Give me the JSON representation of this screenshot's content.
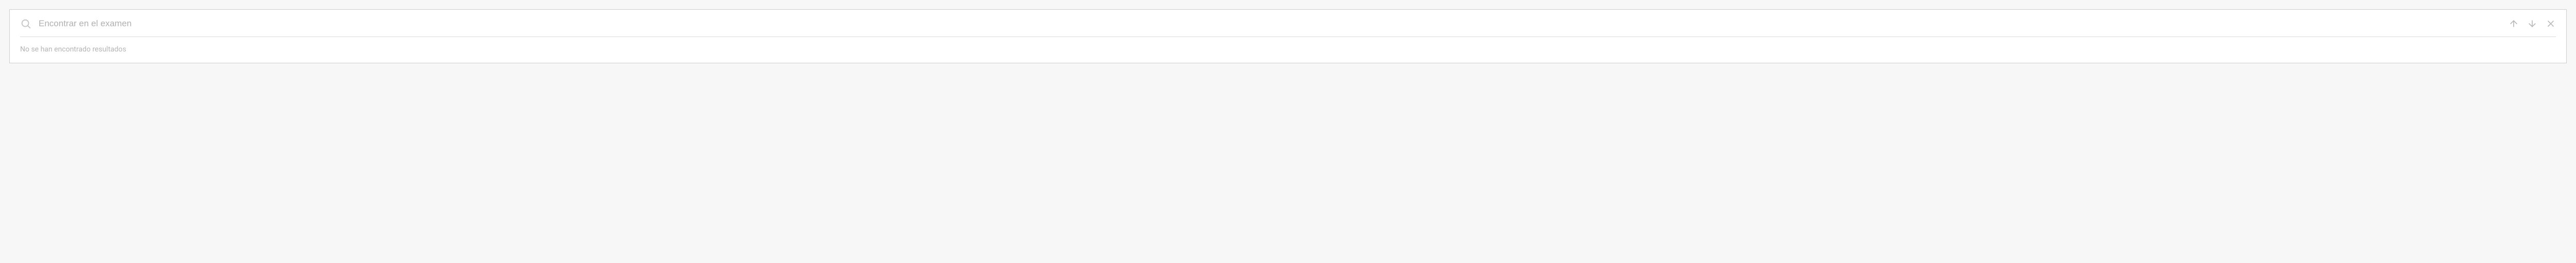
{
  "search": {
    "placeholder": "Encontrar en el examen",
    "value": ""
  },
  "status": {
    "no_results": "No se han encontrado resultados"
  }
}
